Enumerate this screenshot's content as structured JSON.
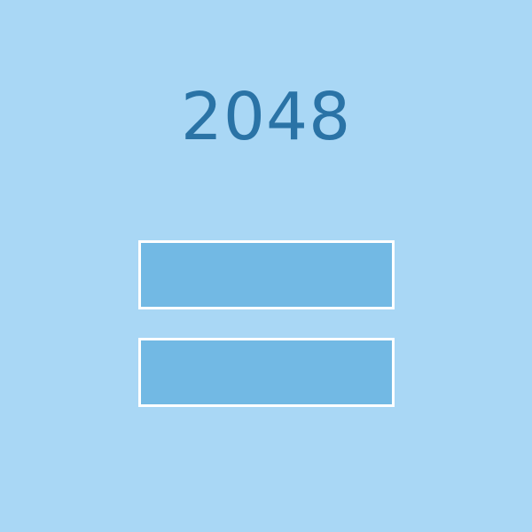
{
  "game": {
    "title": "2048"
  },
  "menu": {
    "buttons": [
      {
        "label": ""
      },
      {
        "label": ""
      }
    ]
  },
  "colors": {
    "background": "#a9d7f5",
    "title": "#2a73a6",
    "button_fill": "#72b9e4",
    "button_border": "#ffffff"
  }
}
